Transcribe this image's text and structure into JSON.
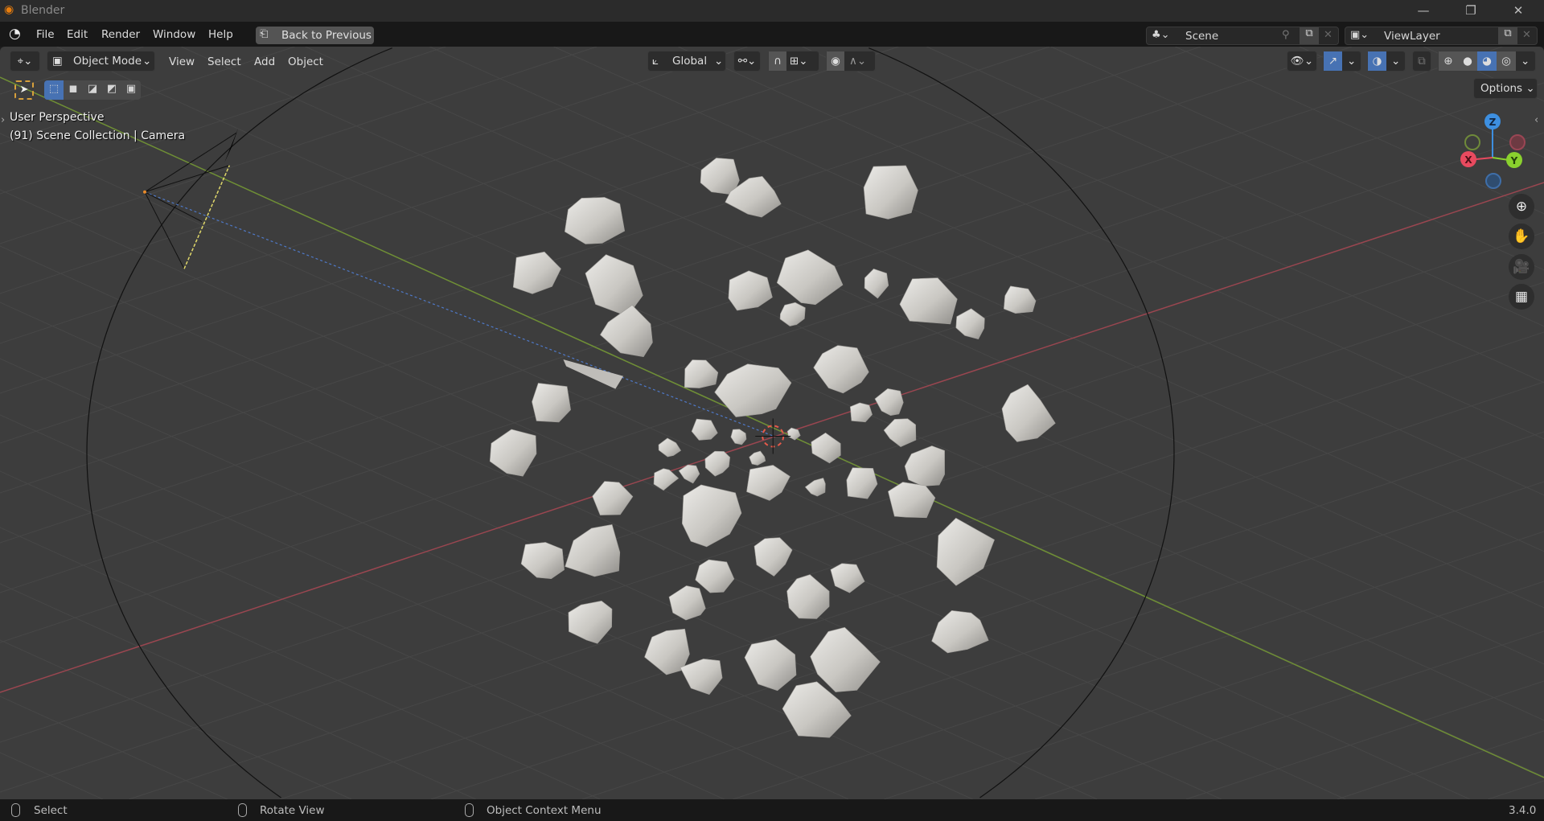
{
  "window": {
    "title": "Blender",
    "minimize": "—",
    "maximize": "❐",
    "close": "✕"
  },
  "menubar": {
    "items": [
      "File",
      "Edit",
      "Render",
      "Window",
      "Help"
    ],
    "back_button": "Back to Previous",
    "scene": "Scene",
    "view_layer": "ViewLayer"
  },
  "header": {
    "mode": "Object Mode",
    "menus": [
      "View",
      "Select",
      "Add",
      "Object"
    ],
    "orientation": "Global",
    "options": "Options"
  },
  "overlay": {
    "view_name": "User Perspective",
    "context": "(91) Scene Collection | Camera"
  },
  "gizmo": {
    "z": "Z",
    "x": "X",
    "y": "Y"
  },
  "statusbar": {
    "left": "Select",
    "middle": "Rotate View",
    "right": "Object Context Menu",
    "version": "3.4.0"
  },
  "colors": {
    "accent": "#4772b3",
    "x_axis": "#e84a5f",
    "y_axis": "#8ad12e",
    "z_axis": "#3d8fe0",
    "background": "#3d3d3d"
  }
}
